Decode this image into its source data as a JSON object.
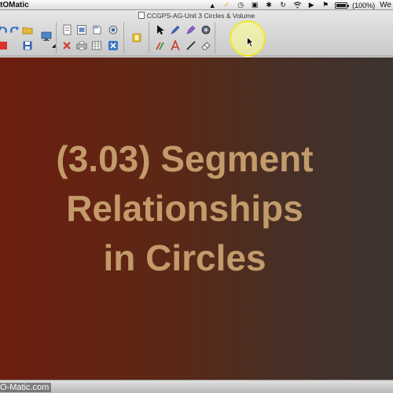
{
  "menubar": {
    "app_name": "tOMatic",
    "battery_percent": "(100%)",
    "battery_level": 1.0,
    "clock": "We"
  },
  "window": {
    "title": "CCGPS-AG-Unit 3 Circles & Volume"
  },
  "toolbar": {
    "icons": [
      "undo-icon",
      "redo-icon",
      "open-folder-icon",
      "save-icon",
      "screen-icon",
      "new-page-icon",
      "clone-page-icon",
      "delete-page-icon",
      "print-icon",
      "table-icon",
      "image-icon",
      "close-icon",
      "gallery-icon",
      "select-arrow-icon",
      "pen-icon",
      "highlighter-icon",
      "fill-icon",
      "magic-pen-icon",
      "text-icon",
      "line-icon",
      "eraser-icon"
    ]
  },
  "slide": {
    "title_line_1": "(3.03) Segment",
    "title_line_2": "Relationships",
    "title_line_3": "in Circles"
  },
  "footer": {
    "watermark": "O-Matic.com"
  },
  "colors": {
    "slide_gradient_start": "#6d1e0e",
    "slide_gradient_end": "#3d3430",
    "title_text": "#c39a6a",
    "highlight": "#f4ea3a"
  }
}
